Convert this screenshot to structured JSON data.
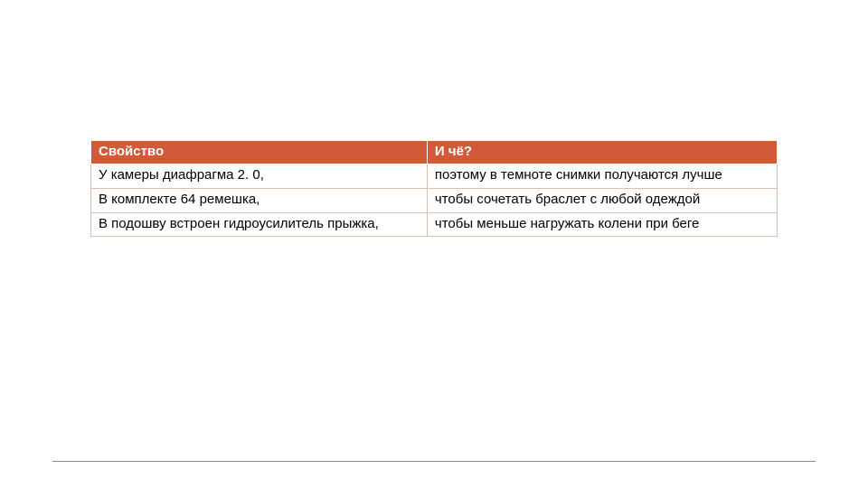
{
  "table": {
    "headers": {
      "col1": "Свойство",
      "col2": "И чё?"
    },
    "rows": [
      {
        "c1": "У камеры диафрагма 2. 0,",
        "c2": "поэтому в темноте снимки получаются лучше"
      },
      {
        "c1": "В комплекте 64 ремешка,",
        "c2": "чтобы сочетать браслет с любой одеждой"
      },
      {
        "c1": "В подошву встроен гидроусилитель прыжка,",
        "c2": "чтобы меньше нагружать колени при беге"
      }
    ]
  }
}
